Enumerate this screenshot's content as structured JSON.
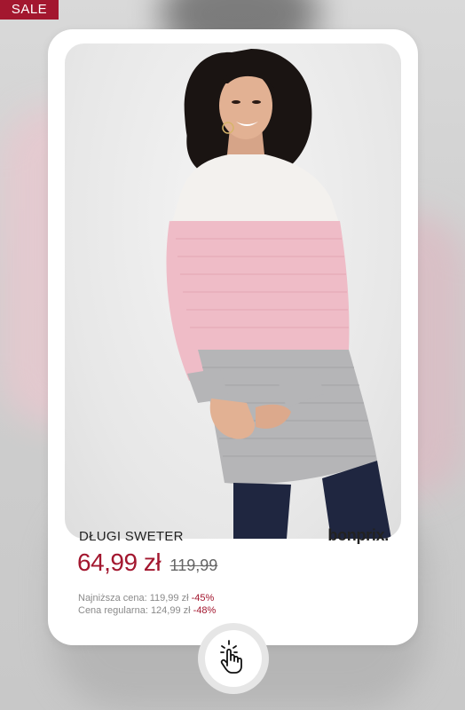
{
  "sale_badge": "SALE",
  "product": {
    "name": "DŁUGI SWETER",
    "brand": "bonprix.",
    "price_current": "64,99 zł",
    "price_old": "119,99",
    "lowest_price_label": "Najniższa cena: 119,99 zł",
    "lowest_price_discount": "-45%",
    "regular_price_label": "Cena regularna: 124,99 zł",
    "regular_price_discount": "-48%"
  },
  "colors": {
    "accent": "#a3172f",
    "sweater_white": "#f3f1ee",
    "sweater_pink": "#efbcc7",
    "sweater_grey": "#b5b5b7",
    "jeans": "#1f2640"
  },
  "icons": {
    "cta": "tap-hand-icon"
  }
}
